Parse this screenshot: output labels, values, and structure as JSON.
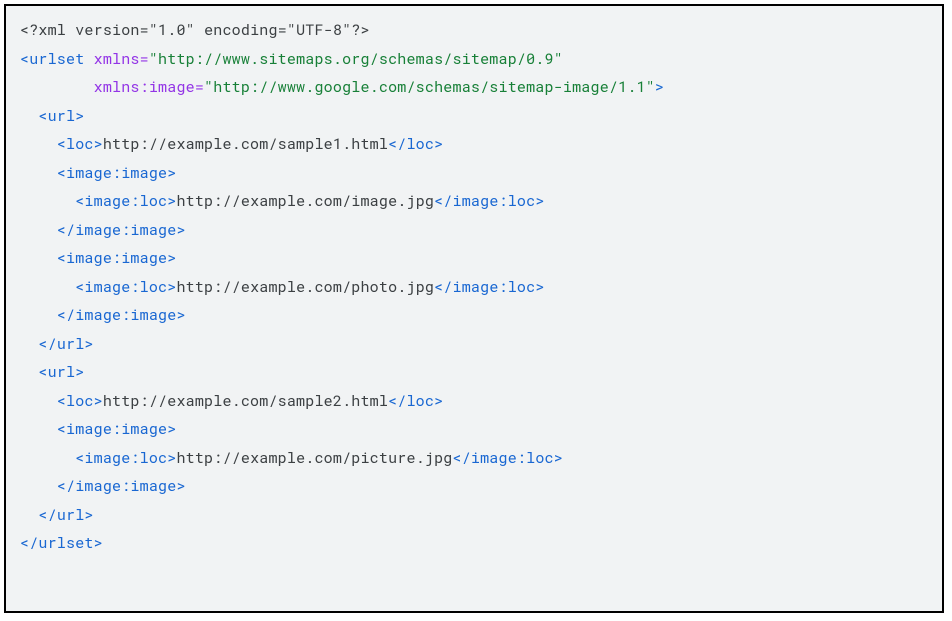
{
  "code": {
    "l1": {
      "pi_open": "<?",
      "pi_name": "xml",
      "attr1_name": "version",
      "attr1_val": "\"1.0\"",
      "attr2_name": "encoding",
      "attr2_val": "\"UTF-8\"",
      "pi_close": "?>"
    },
    "l2": {
      "open": "<",
      "tag": "urlset",
      "attr_name": "xmlns",
      "eq": "=",
      "attr_val": "\"http://www.sitemaps.org/schemas/sitemap/0.9\""
    },
    "l3": {
      "attr_name": "xmlns:image",
      "eq": "=",
      "attr_val": "\"http://www.google.com/schemas/sitemap-image/1.1\"",
      "close": ">"
    },
    "l4": {
      "open": "<",
      "tag": "url",
      "close": ">"
    },
    "l5": {
      "open": "<",
      "tag": "loc",
      "close": ">",
      "text": "http://example.com/sample1.html",
      "copen": "</",
      "ctag": "loc",
      "cclose": ">"
    },
    "l6": {
      "open": "<",
      "tag": "image:image",
      "close": ">"
    },
    "l7": {
      "open": "<",
      "tag": "image:loc",
      "close": ">",
      "text": "http://example.com/image.jpg",
      "copen": "</",
      "ctag": "image:loc",
      "cclose": ">"
    },
    "l8": {
      "open": "</",
      "tag": "image:image",
      "close": ">"
    },
    "l9": {
      "open": "<",
      "tag": "image:image",
      "close": ">"
    },
    "l10": {
      "open": "<",
      "tag": "image:loc",
      "close": ">",
      "text": "http://example.com/photo.jpg",
      "copen": "</",
      "ctag": "image:loc",
      "cclose": ">"
    },
    "l11": {
      "open": "</",
      "tag": "image:image",
      "close": ">"
    },
    "l12": {
      "open": "</",
      "tag": "url",
      "close": ">"
    },
    "l13": {
      "open": "<",
      "tag": "url",
      "close": ">"
    },
    "l14": {
      "open": "<",
      "tag": "loc",
      "close": ">",
      "text": "http://example.com/sample2.html",
      "copen": "</",
      "ctag": "loc",
      "cclose": ">"
    },
    "l15": {
      "open": "<",
      "tag": "image:image",
      "close": ">"
    },
    "l16": {
      "open": "<",
      "tag": "image:loc",
      "close": ">",
      "text": "http://example.com/picture.jpg",
      "copen": "</",
      "ctag": "image:loc",
      "cclose": ">"
    },
    "l17": {
      "open": "</",
      "tag": "image:image",
      "close": ">"
    },
    "l18": {
      "open": "</",
      "tag": "url",
      "close": ">"
    },
    "l19": {
      "open": "</",
      "tag": "urlset",
      "close": ">"
    }
  }
}
